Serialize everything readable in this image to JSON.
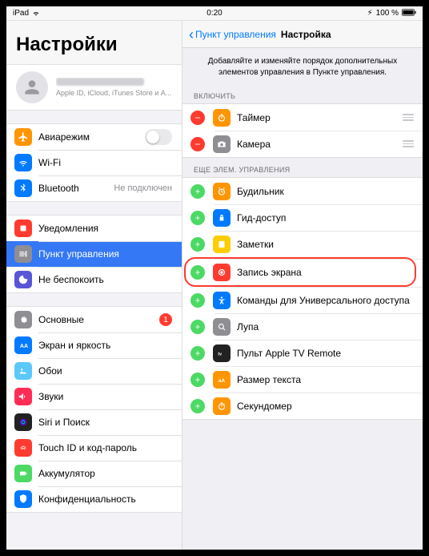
{
  "status": {
    "device": "iPad",
    "time": "0:20",
    "battery": "100 %"
  },
  "left": {
    "title": "Настройки",
    "account_sub": "Apple ID, iCloud, iTunes Store и A...",
    "g1": {
      "airplane": "Авиарежим",
      "wifi": "Wi-Fi",
      "bt": "Bluetooth",
      "bt_val": "Не подключен"
    },
    "g2": {
      "notify": "Уведомления",
      "cc": "Пункт управления",
      "dnd": "Не беспокоить"
    },
    "g3": {
      "general": "Основные",
      "general_badge": "1",
      "display": "Экран и яркость",
      "wallpaper": "Обои",
      "sounds": "Звуки",
      "siri": "Siri и Поиск",
      "touchid": "Touch ID и код-пароль",
      "battery": "Аккумулятор",
      "privacy": "Конфиденциальность"
    }
  },
  "right": {
    "back": "Пункт управления",
    "title": "Настройка",
    "hint": "Добавляйте и изменяйте порядок дополнительных элементов управления в Пункте управления.",
    "included_hdr": "ВКЛЮЧИТЬ",
    "included": {
      "timer": "Таймер",
      "camera": "Камера"
    },
    "more_hdr": "ЕЩЕ ЭЛЕМ. УПРАВЛЕНИЯ",
    "more": {
      "alarm": "Будильник",
      "guided": "Гид-доступ",
      "notes": "Заметки",
      "screenrec": "Запись экрана",
      "access": "Команды для Универсального доступа",
      "magnifier": "Лупа",
      "appletv": "Пульт Apple TV Remote",
      "textsize": "Размер текста",
      "stopwatch": "Секундомер"
    }
  }
}
